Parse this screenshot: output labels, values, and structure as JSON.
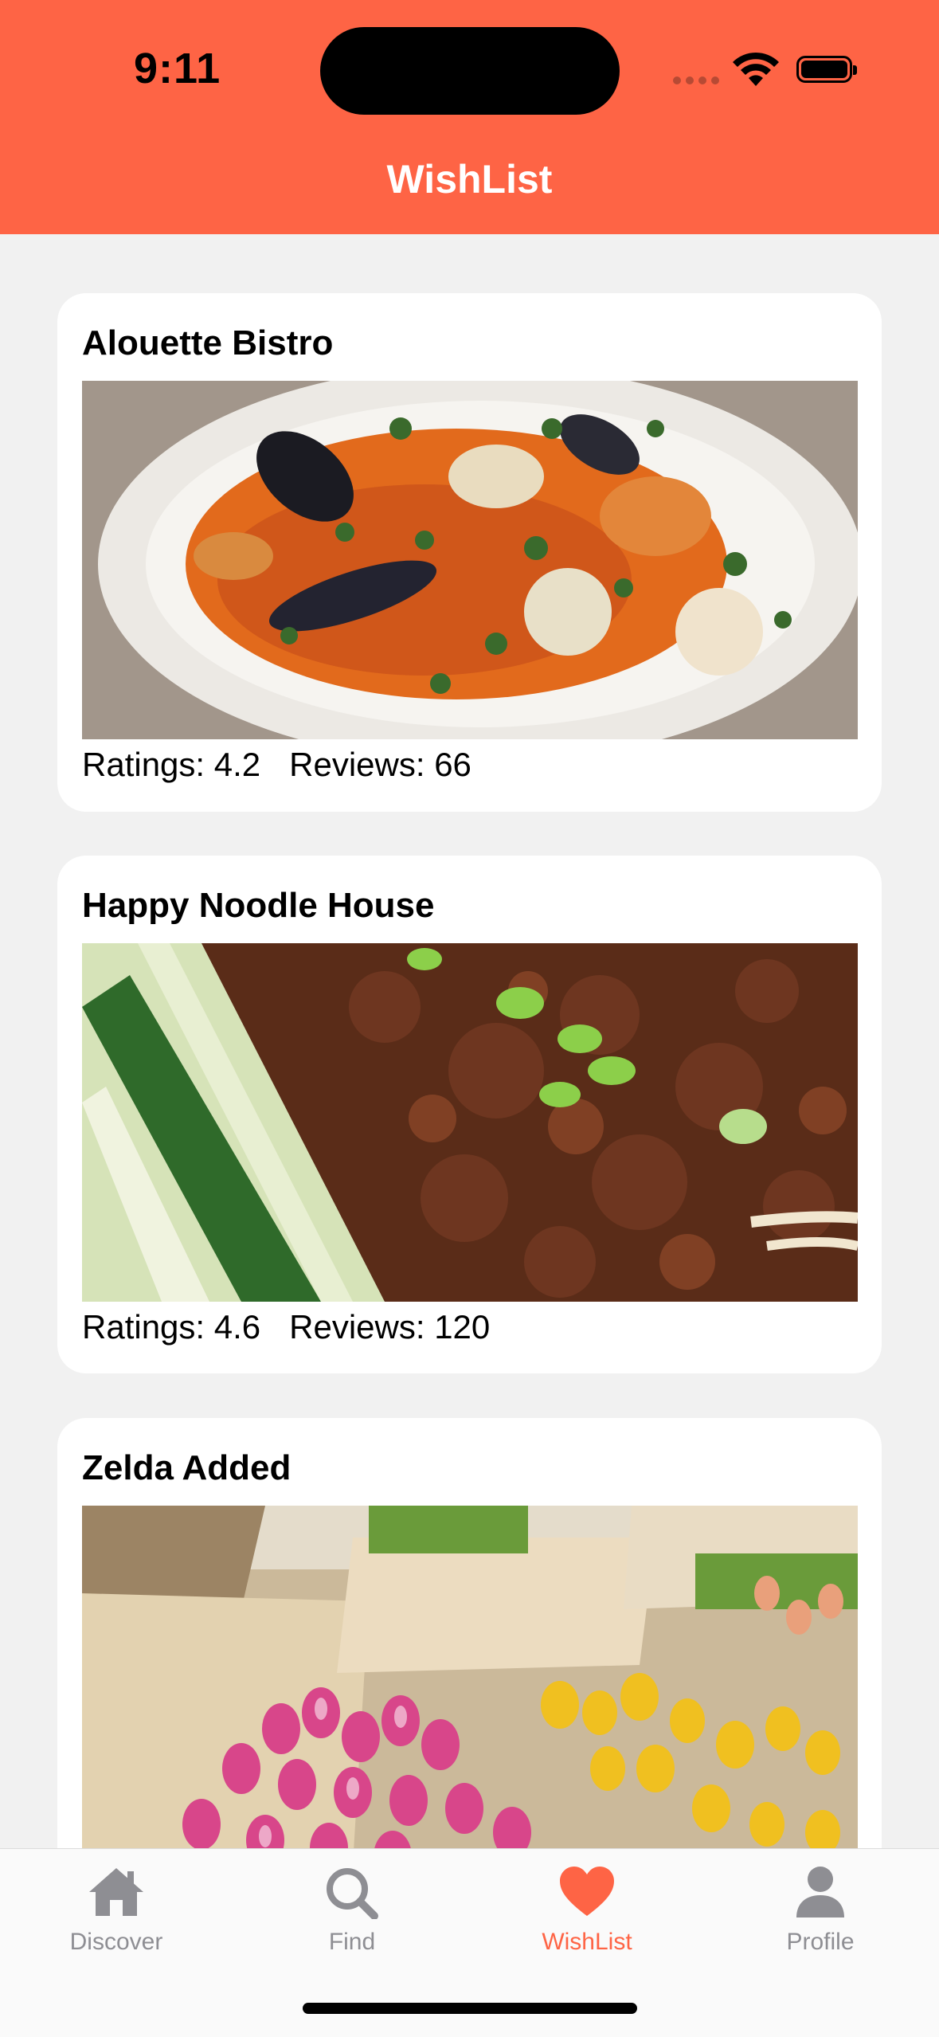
{
  "status_bar": {
    "time": "9:11"
  },
  "nav": {
    "title": "WishList"
  },
  "cards": [
    {
      "name": "Alouette Bistro",
      "rating_label": "Ratings: 4.2",
      "reviews_label": "Reviews: 66"
    },
    {
      "name": "Happy Noodle House",
      "rating_label": "Ratings: 4.6",
      "reviews_label": "Reviews: 120"
    },
    {
      "name": "Zelda Added"
    }
  ],
  "tabs": [
    {
      "label": "Discover",
      "icon": "home-icon"
    },
    {
      "label": "Find",
      "icon": "search-icon"
    },
    {
      "label": "WishList",
      "icon": "heart-icon",
      "active": true
    },
    {
      "label": "Profile",
      "icon": "person-icon"
    }
  ],
  "colors": {
    "accent": "#fe6445",
    "inactive_tab": "#8e8e93",
    "background": "#f1f1f1"
  }
}
